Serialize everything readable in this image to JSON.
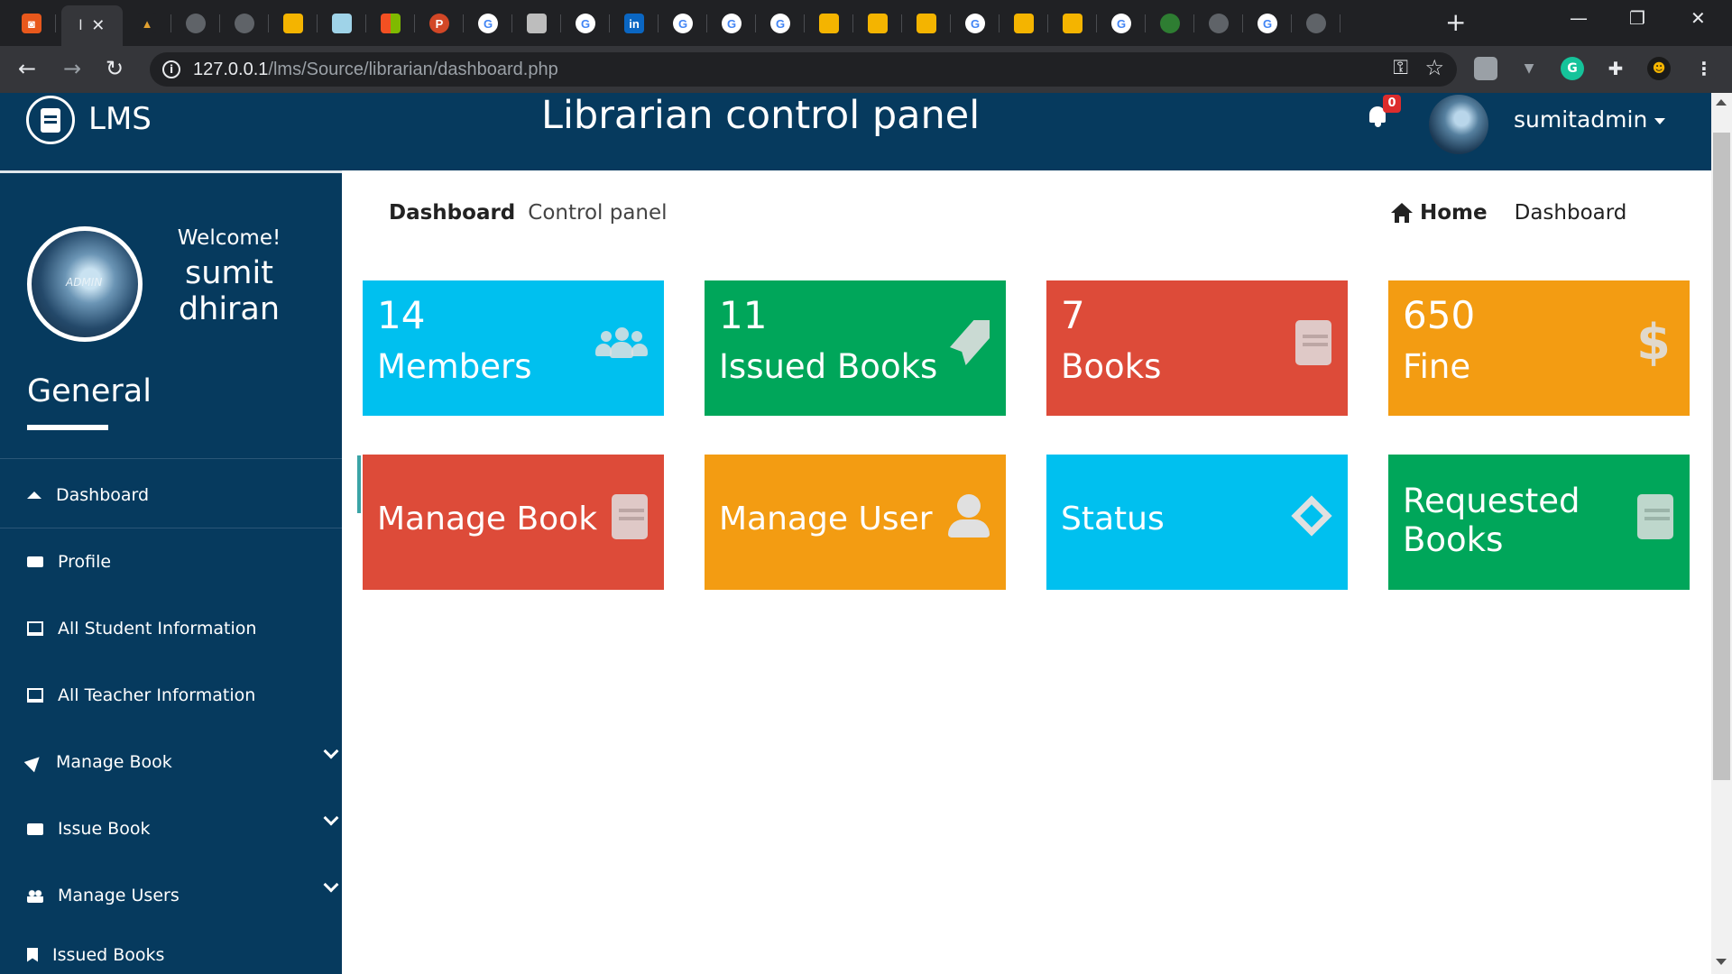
{
  "browser": {
    "active_tab_title": "l",
    "tab_close": "✕",
    "new_tab": "+",
    "url_host": "127.0.0.1",
    "url_path": "/lms/Source/librarian/dashboard.php",
    "minimize": "—",
    "restore": "❐",
    "close": "✕",
    "back": "←",
    "forward": "→",
    "reload": "↻"
  },
  "header": {
    "logo_text": "LMS",
    "title": "Librarian control panel",
    "notification_count": "0",
    "username": "sumitadmin"
  },
  "sidebar": {
    "avatar_text": "ADMIN",
    "welcome": "Welcome!",
    "user_first": "sumit",
    "user_last": "dhiran",
    "section_title": "General",
    "items": [
      {
        "label": "Dashboard",
        "icon": "home-icon"
      },
      {
        "label": "Profile",
        "icon": "id-card-icon"
      },
      {
        "label": "All Student Information",
        "icon": "monitor-icon"
      },
      {
        "label": "All Teacher Information",
        "icon": "monitor-icon"
      },
      {
        "label": "Manage Book",
        "icon": "paper-plane-icon"
      },
      {
        "label": "Issue Book",
        "icon": "list-icon"
      },
      {
        "label": "Manage Users",
        "icon": "users-icon"
      },
      {
        "label": "Issued Books",
        "icon": "bookmark-icon"
      }
    ]
  },
  "breadcrumb": {
    "title": "Dashboard",
    "subtitle": "Control panel",
    "home": "Home",
    "current": "Dashboard"
  },
  "stats": [
    {
      "value": "14",
      "label": "Members",
      "color": "#00c0ef",
      "icon": "users-icon"
    },
    {
      "value": "11",
      "label": "Issued Books",
      "color": "#00a65a",
      "icon": "rocket-icon"
    },
    {
      "value": "7",
      "label": "Books",
      "color": "#dd4b39",
      "icon": "book-icon"
    },
    {
      "value": "650",
      "label": "Fine",
      "color": "#f39c12",
      "icon": "dollar-icon"
    }
  ],
  "actions": [
    {
      "label": "Manage Book",
      "color": "#dd4b39",
      "icon": "book-icon"
    },
    {
      "label": "Manage User",
      "color": "#f39c12",
      "icon": "user-icon"
    },
    {
      "label": "Status",
      "color": "#00c0ef",
      "icon": "diamond-icon"
    },
    {
      "label_line1": "Requested",
      "label_line2": "Books",
      "color": "#00a65a",
      "icon": "book-icon"
    }
  ]
}
